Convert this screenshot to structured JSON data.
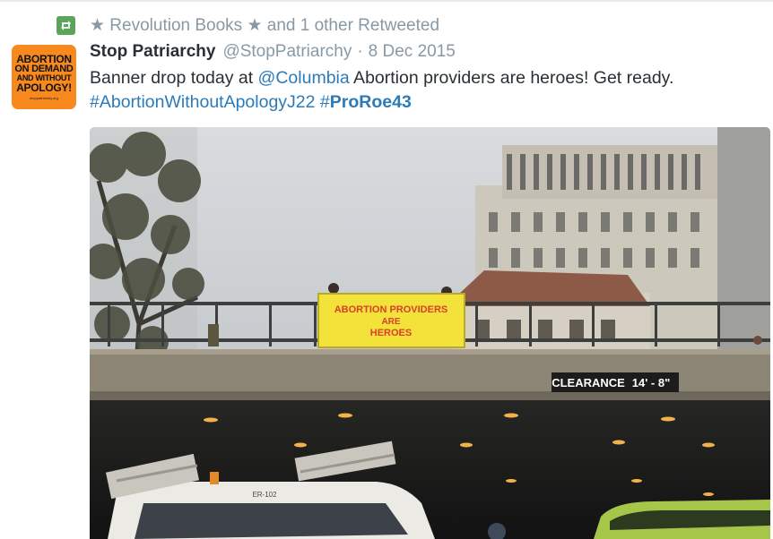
{
  "retweet": {
    "text": "★ Revolution Books ★ and 1 other Retweeted",
    "icon": "retweet-icon",
    "icon_color": "#5aa55a"
  },
  "author": {
    "name": "Stop Patriarchy",
    "handle": "@StopPatriarchy",
    "separator": "·",
    "date": "8 Dec 2015",
    "avatar_lines": [
      "ABORTION",
      "ON DEMAND",
      "AND WITHOUT",
      "APOLOGY!"
    ],
    "avatar_url_text": "stoppatriarchy.org",
    "avatar_color": "#f7891e"
  },
  "tweet": {
    "text_before": "Banner drop today at ",
    "mention": "@Columbia",
    "text_after": " Abortion providers are heroes! Get ready.",
    "hashtag1": "#AbortionWithoutApologyJ22",
    "hashtag2_hash": "#",
    "hashtag2_word": "ProRoe43"
  },
  "photo": {
    "banner_line1": "ABORTION PROVIDERS",
    "banner_line2": "ARE",
    "banner_line3": "HEROES",
    "clearance_label": "CLEARANCE",
    "clearance_value": "14' - 8\"",
    "truck_plate": "ER-102"
  },
  "colors": {
    "link": "#2b7bb9",
    "name": "#292f33",
    "meta": "#8899a6",
    "banner": "#f2e23a"
  }
}
